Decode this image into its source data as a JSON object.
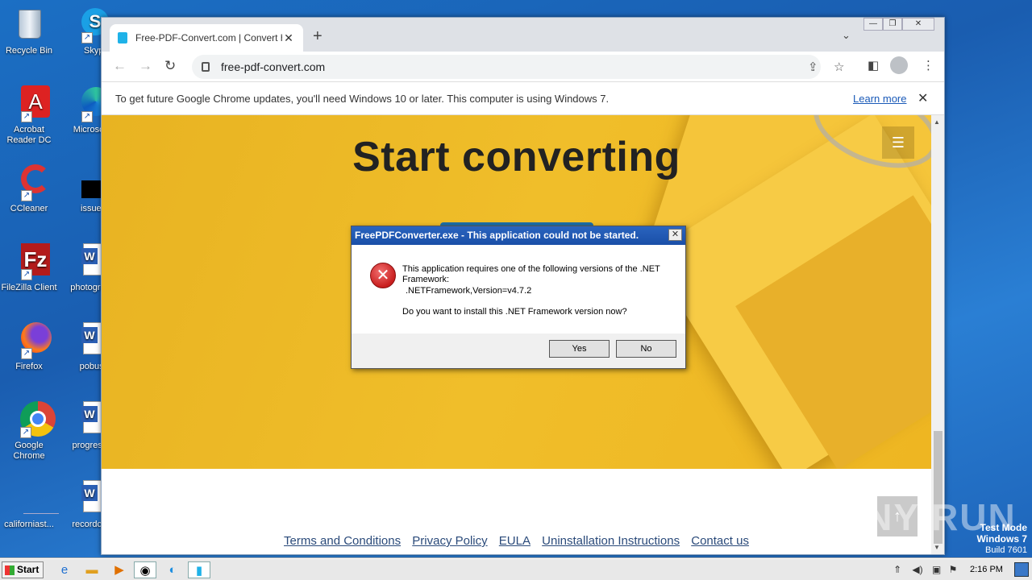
{
  "desktop": {
    "icons": [
      {
        "label": "Recycle Bin"
      },
      {
        "label": "Skype"
      },
      {
        "label": "Acrobat Reader DC"
      },
      {
        "label": "Microsoft"
      },
      {
        "label": "CCleaner"
      },
      {
        "label": "issuesimp"
      },
      {
        "label": "FileZilla Client"
      },
      {
        "label": "photograp"
      },
      {
        "label": "Firefox"
      },
      {
        "label": "pobus.r"
      },
      {
        "label": "Google Chrome"
      },
      {
        "label": "progresso"
      },
      {
        "label": "californiast..."
      },
      {
        "label": "recordclo"
      }
    ]
  },
  "browser": {
    "tab_title": "Free-PDF-Convert.com | Convert hu",
    "url": "free-pdf-convert.com",
    "infobar": {
      "message": "To get future Google Chrome updates, you'll need Windows 10 or later. This computer is using Windows 7.",
      "link": "Learn more"
    },
    "page": {
      "heading": "Start converting",
      "footer_links": [
        "Terms and Conditions",
        "Privacy Policy",
        "EULA",
        "Uninstallation Instructions",
        "Contact us"
      ]
    }
  },
  "dialog": {
    "title": "FreePDFConverter.exe - This application could not be started.",
    "line1": "This application requires one of the following versions of the .NET Framework:",
    "line2": ".NETFramework,Version=v4.7.2",
    "line3": "Do you want to install this .NET Framework version now?",
    "yes": "Yes",
    "no": "No"
  },
  "taskbar": {
    "start": "Start",
    "clock": "2:16 PM"
  },
  "watermark": "ANY RUN",
  "test_mode": {
    "line1": "Test Mode",
    "line2": "Windows 7",
    "line3": "Build 7601"
  }
}
